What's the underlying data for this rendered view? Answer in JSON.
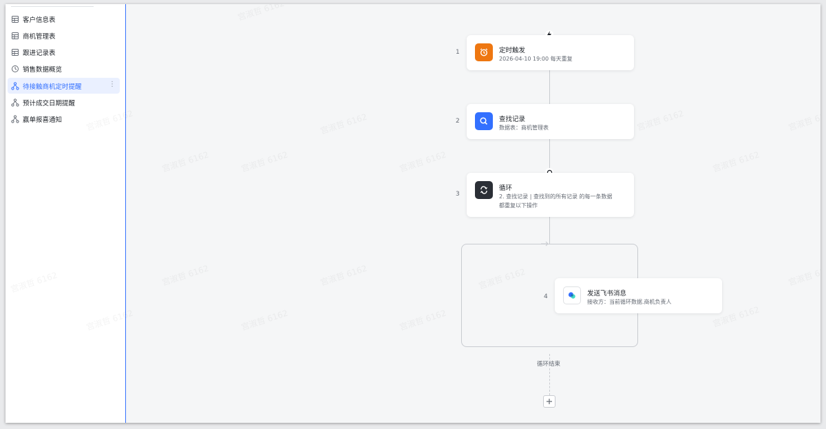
{
  "sidebar": {
    "items": [
      {
        "label": "客户信息表",
        "icon": "table-icon"
      },
      {
        "label": "商机管理表",
        "icon": "table-icon"
      },
      {
        "label": "跟进记录表",
        "icon": "table-icon"
      },
      {
        "label": "销售数据概览",
        "icon": "dashboard-icon"
      },
      {
        "label": "待接触商机定时提醒",
        "icon": "workflow-icon",
        "active": true
      },
      {
        "label": "预计成交日期提醒",
        "icon": "workflow-icon"
      },
      {
        "label": "赢单报喜通知",
        "icon": "workflow-icon"
      }
    ]
  },
  "flow": {
    "nodes": [
      {
        "step": "1",
        "title": "定时触发",
        "desc": "2026-04-10 19:00 每天重复",
        "icon": "alarm-clock-icon",
        "color": "#ee7711"
      },
      {
        "step": "2",
        "title": "查找记录",
        "desc": "数据表：商机管理表",
        "icon": "search-icon",
        "color": "#3370ff"
      },
      {
        "step": "3",
        "title": "循环",
        "desc": "2. 查找记录 | 查找到的所有记录 的每一条数据",
        "desc2": "都重复以下操作",
        "icon": "loop-icon",
        "color": "#2b2f36"
      },
      {
        "step": "4",
        "title": "发送飞书消息",
        "desc": "接收方：当前循环数据.商机负责人",
        "icon": "feishu-icon",
        "color": "#ffffff"
      }
    ],
    "loop_end_label": "循环结束"
  },
  "watermark": "宫淑哲 6162"
}
